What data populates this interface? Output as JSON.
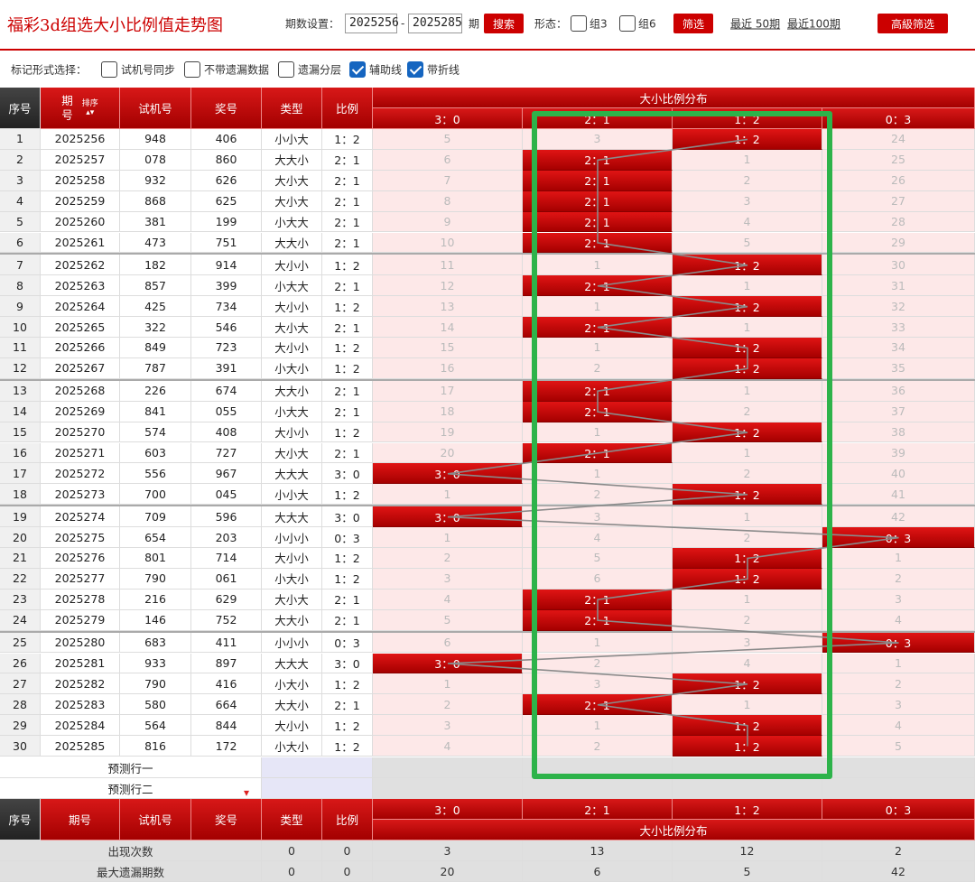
{
  "header": {
    "title": "福彩3d组选大小比例值走势图",
    "period_label": "期数设置：",
    "period_start": "2025256",
    "dash": "-",
    "period_end": "2025285",
    "period_unit": "期",
    "search_btn": "搜索",
    "form_label": "形态：",
    "group3": "组3",
    "group6": "组6",
    "filter_btn": "筛选",
    "recent50": "最近 50期",
    "recent100": "最近100期",
    "advanced_btn": "高級筛选"
  },
  "markbar": {
    "label": "标记形式选择：",
    "options": [
      {
        "label": "试机号同步",
        "checked": false
      },
      {
        "label": "不带遗漏数据",
        "checked": false
      },
      {
        "label": "遗漏分层",
        "checked": false
      },
      {
        "label": "辅助线",
        "checked": true
      },
      {
        "label": "带折线",
        "checked": true
      }
    ]
  },
  "table": {
    "head": {
      "seq": "序号",
      "issue_a": "期",
      "issue_b": "号",
      "sort": "排序",
      "test": "试机号",
      "prize": "奖号",
      "type": "类型",
      "ratio": "比例",
      "dist": "大小比例分布",
      "cols": [
        "3：0",
        "2：1",
        "1：2",
        "0：3"
      ]
    },
    "rows": [
      {
        "seq": "1",
        "issue": "2025256",
        "test": "948",
        "prize": "406",
        "type": "小小大",
        "ratio": "1：2",
        "dist": [
          "5",
          "3",
          "1：2",
          "24"
        ]
      },
      {
        "seq": "2",
        "issue": "2025257",
        "test": "078",
        "prize": "860",
        "type": "大大小",
        "ratio": "2：1",
        "dist": [
          "6",
          "2：1",
          "1",
          "25"
        ]
      },
      {
        "seq": "3",
        "issue": "2025258",
        "test": "932",
        "prize": "626",
        "type": "大小大",
        "ratio": "2：1",
        "dist": [
          "7",
          "2：1",
          "2",
          "26"
        ]
      },
      {
        "seq": "4",
        "issue": "2025259",
        "test": "868",
        "prize": "625",
        "type": "大小大",
        "ratio": "2：1",
        "dist": [
          "8",
          "2：1",
          "3",
          "27"
        ]
      },
      {
        "seq": "5",
        "issue": "2025260",
        "test": "381",
        "prize": "199",
        "type": "小大大",
        "ratio": "2：1",
        "dist": [
          "9",
          "2：1",
          "4",
          "28"
        ]
      },
      {
        "seq": "6",
        "issue": "2025261",
        "test": "473",
        "prize": "751",
        "type": "大大小",
        "ratio": "2：1",
        "dist": [
          "10",
          "2：1",
          "5",
          "29"
        ]
      },
      {
        "seq": "7",
        "issue": "2025262",
        "test": "182",
        "prize": "914",
        "type": "大小小",
        "ratio": "1：2",
        "dist": [
          "11",
          "1",
          "1：2",
          "30"
        ]
      },
      {
        "seq": "8",
        "issue": "2025263",
        "test": "857",
        "prize": "399",
        "type": "小大大",
        "ratio": "2：1",
        "dist": [
          "12",
          "2：1",
          "1",
          "31"
        ]
      },
      {
        "seq": "9",
        "issue": "2025264",
        "test": "425",
        "prize": "734",
        "type": "大小小",
        "ratio": "1：2",
        "dist": [
          "13",
          "1",
          "1：2",
          "32"
        ]
      },
      {
        "seq": "10",
        "issue": "2025265",
        "test": "322",
        "prize": "546",
        "type": "大小大",
        "ratio": "2：1",
        "dist": [
          "14",
          "2：1",
          "1",
          "33"
        ]
      },
      {
        "seq": "11",
        "issue": "2025266",
        "test": "849",
        "prize": "723",
        "type": "大小小",
        "ratio": "1：2",
        "dist": [
          "15",
          "1",
          "1：2",
          "34"
        ]
      },
      {
        "seq": "12",
        "issue": "2025267",
        "test": "787",
        "prize": "391",
        "type": "小大小",
        "ratio": "1：2",
        "dist": [
          "16",
          "2",
          "1：2",
          "35"
        ]
      },
      {
        "seq": "13",
        "issue": "2025268",
        "test": "226",
        "prize": "674",
        "type": "大大小",
        "ratio": "2：1",
        "dist": [
          "17",
          "2：1",
          "1",
          "36"
        ]
      },
      {
        "seq": "14",
        "issue": "2025269",
        "test": "841",
        "prize": "055",
        "type": "小大大",
        "ratio": "2：1",
        "dist": [
          "18",
          "2：1",
          "2",
          "37"
        ]
      },
      {
        "seq": "15",
        "issue": "2025270",
        "test": "574",
        "prize": "408",
        "type": "大小小",
        "ratio": "1：2",
        "dist": [
          "19",
          "1",
          "1：2",
          "38"
        ]
      },
      {
        "seq": "16",
        "issue": "2025271",
        "test": "603",
        "prize": "727",
        "type": "大小大",
        "ratio": "2：1",
        "dist": [
          "20",
          "2：1",
          "1",
          "39"
        ]
      },
      {
        "seq": "17",
        "issue": "2025272",
        "test": "556",
        "prize": "967",
        "type": "大大大",
        "ratio": "3：0",
        "dist": [
          "3：0",
          "1",
          "2",
          "40"
        ]
      },
      {
        "seq": "18",
        "issue": "2025273",
        "test": "700",
        "prize": "045",
        "type": "小小大",
        "ratio": "1：2",
        "dist": [
          "1",
          "2",
          "1：2",
          "41"
        ]
      },
      {
        "seq": "19",
        "issue": "2025274",
        "test": "709",
        "prize": "596",
        "type": "大大大",
        "ratio": "3：0",
        "dist": [
          "3：0",
          "3",
          "1",
          "42"
        ]
      },
      {
        "seq": "20",
        "issue": "2025275",
        "test": "654",
        "prize": "203",
        "type": "小小小",
        "ratio": "0：3",
        "dist": [
          "1",
          "4",
          "2",
          "0：3"
        ]
      },
      {
        "seq": "21",
        "issue": "2025276",
        "test": "801",
        "prize": "714",
        "type": "大小小",
        "ratio": "1：2",
        "dist": [
          "2",
          "5",
          "1：2",
          "1"
        ]
      },
      {
        "seq": "22",
        "issue": "2025277",
        "test": "790",
        "prize": "061",
        "type": "小大小",
        "ratio": "1：2",
        "dist": [
          "3",
          "6",
          "1：2",
          "2"
        ]
      },
      {
        "seq": "23",
        "issue": "2025278",
        "test": "216",
        "prize": "629",
        "type": "大小大",
        "ratio": "2：1",
        "dist": [
          "4",
          "2：1",
          "1",
          "3"
        ]
      },
      {
        "seq": "24",
        "issue": "2025279",
        "test": "146",
        "prize": "752",
        "type": "大大小",
        "ratio": "2：1",
        "dist": [
          "5",
          "2：1",
          "2",
          "4"
        ]
      },
      {
        "seq": "25",
        "issue": "2025280",
        "test": "683",
        "prize": "411",
        "type": "小小小",
        "ratio": "0：3",
        "dist": [
          "6",
          "1",
          "3",
          "0：3"
        ]
      },
      {
        "seq": "26",
        "issue": "2025281",
        "test": "933",
        "prize": "897",
        "type": "大大大",
        "ratio": "3：0",
        "dist": [
          "3：0",
          "2",
          "4",
          "1"
        ]
      },
      {
        "seq": "27",
        "issue": "2025282",
        "test": "790",
        "prize": "416",
        "type": "小大小",
        "ratio": "1：2",
        "dist": [
          "1",
          "3",
          "1：2",
          "2"
        ]
      },
      {
        "seq": "28",
        "issue": "2025283",
        "test": "580",
        "prize": "664",
        "type": "大大小",
        "ratio": "2：1",
        "dist": [
          "2",
          "2：1",
          "1",
          "3"
        ]
      },
      {
        "seq": "29",
        "issue": "2025284",
        "test": "564",
        "prize": "844",
        "type": "大小小",
        "ratio": "1：2",
        "dist": [
          "3",
          "1",
          "1：2",
          "4"
        ]
      },
      {
        "seq": "30",
        "issue": "2025285",
        "test": "816",
        "prize": "172",
        "type": "小大小",
        "ratio": "1：2",
        "dist": [
          "4",
          "2",
          "1：2",
          "5"
        ]
      }
    ],
    "predict": [
      "预测行一",
      "预测行二"
    ],
    "stats": [
      {
        "label": "出现次数",
        "type": "0",
        "ratio": "0",
        "vals": [
          "3",
          "13",
          "12",
          "2"
        ]
      },
      {
        "label": "最大遗漏期数",
        "type": "0",
        "ratio": "0",
        "vals": [
          "20",
          "6",
          "5",
          "42"
        ]
      }
    ]
  },
  "colors": {
    "accent": "#cc0000",
    "highlight": "#22aa44",
    "check": "#1565c0"
  }
}
